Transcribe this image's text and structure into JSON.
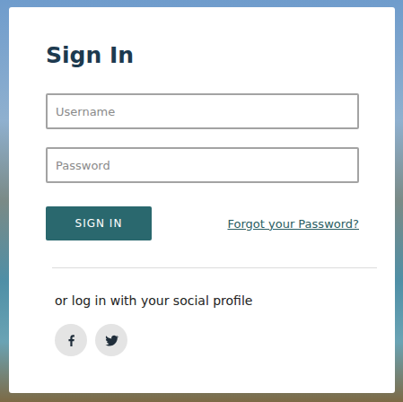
{
  "form": {
    "title": "Sign In",
    "fields": [
      {
        "placeholder": "Username",
        "kind": "text"
      },
      {
        "placeholder": "Password",
        "kind": "password"
      }
    ],
    "submit": "SIGN IN",
    "forgot_link": "Forgot your Password?"
  },
  "social": {
    "label": "or log in with your social profile",
    "providers": [
      {
        "kind": "facebook"
      },
      {
        "kind": "twitter"
      }
    ]
  }
}
